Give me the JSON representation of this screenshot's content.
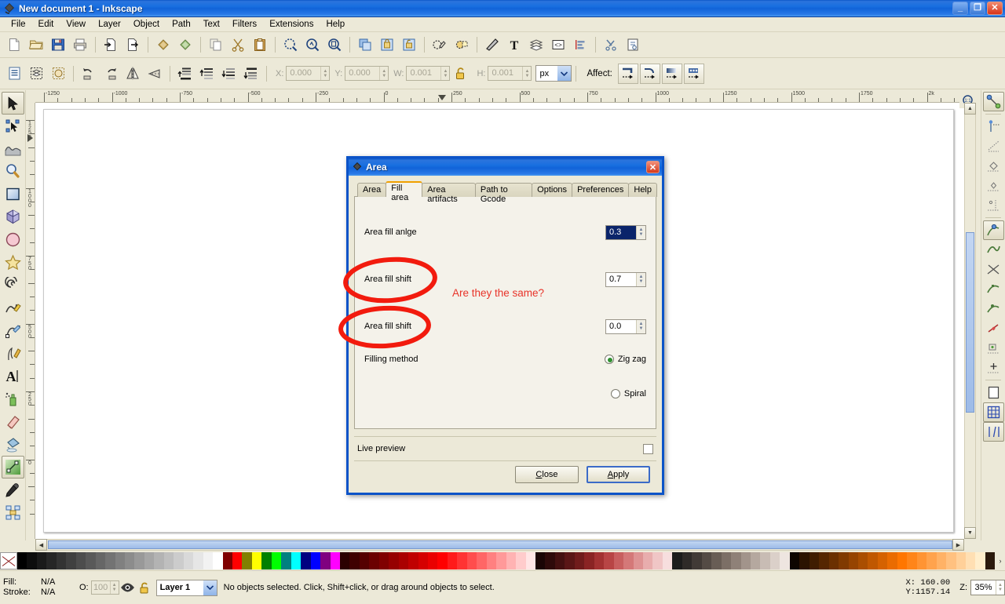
{
  "window": {
    "title": "New document 1 - Inkscape",
    "minimize_label": "_",
    "maximize_label": "❐",
    "close_label": "✕"
  },
  "menu": [
    {
      "label": "File"
    },
    {
      "label": "Edit"
    },
    {
      "label": "View"
    },
    {
      "label": "Layer"
    },
    {
      "label": "Object"
    },
    {
      "label": "Path"
    },
    {
      "label": "Text"
    },
    {
      "label": "Filters"
    },
    {
      "label": "Extensions"
    },
    {
      "label": "Help"
    }
  ],
  "command_bar": {
    "buttons": [
      "new-document-icon",
      "open-document-icon",
      "save-document-icon",
      "print-icon",
      "import-icon",
      "export-icon",
      "undo-icon",
      "redo-icon",
      "copy-icon",
      "cut-icon",
      "paste-icon",
      "zoom-selection-icon",
      "zoom-drawing-icon",
      "zoom-page-icon",
      "duplicate-icon",
      "group-icon",
      "ungroup-icon",
      "fill-stroke-dialog-icon",
      "object-properties-icon",
      "edit-gradient-icon",
      "text-tool-icon",
      "layers-dialog-icon",
      "xml-editor-icon",
      "align-dialog-icon",
      "preferences-icon",
      "document-properties-icon"
    ]
  },
  "selector_bar": {
    "buttons": [
      "select-all-icon",
      "select-all-in-layers-icon",
      "deselect-icon",
      "rotate-ccw-icon",
      "rotate-cw-icon",
      "flip-horizontal-icon",
      "flip-vertical-icon",
      "raise-to-top-icon",
      "raise-icon",
      "lower-icon",
      "lower-to-bottom-icon"
    ],
    "x_label": "X:",
    "x_value": "0.000",
    "y_label": "Y:",
    "y_value": "0.000",
    "w_label": "W:",
    "w_value": "0.001",
    "lock_icon": "unlocked-padlock-icon",
    "h_label": "H:",
    "h_value": "0.001",
    "unit_value": "px",
    "affect_label": "Affect:",
    "affect_buttons": [
      "scale-stroke-width-icon",
      "scale-rounded-corners-icon",
      "move-gradients-icon",
      "move-patterns-icon"
    ]
  },
  "tool_palette": {
    "tools": [
      {
        "name": "selector-tool",
        "active": true
      },
      {
        "name": "node-tool",
        "active": false
      },
      {
        "name": "tweak-tool",
        "active": false
      },
      {
        "name": "zoom-tool",
        "active": false
      },
      {
        "name": "rectangle-tool",
        "active": false
      },
      {
        "name": "3dbox-tool",
        "active": false
      },
      {
        "name": "ellipse-tool",
        "active": false
      },
      {
        "name": "star-tool",
        "active": false
      },
      {
        "name": "spiral-tool",
        "active": false
      },
      {
        "name": "pencil-tool",
        "active": false
      },
      {
        "name": "bezier-tool",
        "active": false
      },
      {
        "name": "calligraphy-tool",
        "active": false
      },
      {
        "name": "text-tool",
        "active": false
      },
      {
        "name": "spray-tool",
        "active": false
      },
      {
        "name": "eraser-tool",
        "active": false
      },
      {
        "name": "paint-bucket-tool",
        "active": false
      },
      {
        "name": "gradient-tool",
        "active": true
      },
      {
        "name": "dropper-tool",
        "active": false
      },
      {
        "name": "connector-tool",
        "active": false
      }
    ]
  },
  "snap_bar": {
    "buttons": [
      {
        "name": "enable-snapping-toggle",
        "on": true
      },
      {
        "name": "snap-bounding-box-toggle",
        "on": false
      },
      {
        "name": "snap-bbox-edges-toggle",
        "on": false
      },
      {
        "name": "snap-bbox-corners-toggle",
        "on": false
      },
      {
        "name": "snap-bbox-edge-midpoints-toggle",
        "on": false
      },
      {
        "name": "snap-bbox-centers-toggle",
        "on": false
      },
      {
        "name": "snap-nodes-paths-toggle",
        "on": true
      },
      {
        "name": "snap-paths-toggle",
        "on": false
      },
      {
        "name": "snap-path-intersections-toggle",
        "on": false
      },
      {
        "name": "snap-cusp-nodes-toggle",
        "on": false
      },
      {
        "name": "snap-smooth-nodes-toggle",
        "on": false
      },
      {
        "name": "snap-line-midpoints-toggle",
        "on": false
      },
      {
        "name": "snap-object-centers-toggle",
        "on": false
      },
      {
        "name": "snap-rotation-centers-toggle",
        "on": false
      },
      {
        "name": "snap-page-border-toggle",
        "on": false
      },
      {
        "name": "snap-grid-toggle",
        "on": true
      },
      {
        "name": "snap-guides-toggle",
        "on": true
      }
    ]
  },
  "rulers": {
    "horizontal_unit_ticks": [
      "-1250",
      "-1000",
      "-750",
      "-500",
      "-250",
      "0",
      "250",
      "500",
      "750",
      "1000",
      "1250",
      "1500",
      "1750",
      "2k"
    ],
    "vertical_unit_ticks": [
      "1250",
      "1000",
      "750",
      "500",
      "250",
      "0"
    ]
  },
  "canvas": {
    "zoom_1to1_icon": "zoom-1to1-icon"
  },
  "dialog": {
    "title": "Area",
    "icon": "inkscape-diamond-icon",
    "close_label": "✕",
    "tabs": [
      {
        "label": "Area",
        "selected": false
      },
      {
        "label": "Fill area",
        "selected": true
      },
      {
        "label": "Area artifacts",
        "selected": false
      },
      {
        "label": "Path to Gcode",
        "selected": false
      },
      {
        "label": "Options",
        "selected": false
      },
      {
        "label": "Preferences",
        "selected": false
      },
      {
        "label": "Help",
        "selected": false
      }
    ],
    "fields": [
      {
        "label": "Area fill anlge",
        "value": "0.3",
        "selected": true
      },
      {
        "label": "Area fill shift",
        "value": "0.7",
        "selected": false
      },
      {
        "label": "Area fill shift",
        "value": "0.0",
        "selected": false
      }
    ],
    "filling_method_label": "Filling method",
    "radios": [
      {
        "label": "Zig zag",
        "checked": true
      },
      {
        "label": "Spiral",
        "checked": false
      }
    ],
    "live_preview_label": "Live preview",
    "live_preview_checked": false,
    "buttons": {
      "close": "Close",
      "close_mnemonic": "C",
      "apply": "Apply",
      "apply_mnemonic": "A"
    }
  },
  "annotation": {
    "text": "Are they the same?",
    "color": "#e8342a",
    "ellipses": 2
  },
  "status_bar": {
    "fill_label": "Fill:",
    "fill_value": "N/A",
    "stroke_label": "Stroke:",
    "stroke_value": "N/A",
    "opacity_label": "O:",
    "opacity_value": "100",
    "visibility_icon": "eye-icon",
    "lock_icon": "padlock-icon",
    "layer_name": "Layer 1",
    "message": "No objects selected. Click, Shift+click, or drag around objects to select.",
    "x_label": "X:",
    "x_value": "160.00",
    "y_label": "Y:",
    "y_value": "1157.14",
    "zoom_label": "Z:",
    "zoom_value": "35%"
  },
  "palette": {
    "none_swatch_name": "no-color-swatch",
    "colors": [
      "#000000",
      "#0d0d0d",
      "#1a1a1a",
      "#262626",
      "#333333",
      "#404040",
      "#4d4d4d",
      "#595959",
      "#666666",
      "#737373",
      "#808080",
      "#8c8c8c",
      "#999999",
      "#a6a6a6",
      "#b3b3b3",
      "#bfbfbf",
      "#cccccc",
      "#d9d9d9",
      "#e6e6e6",
      "#f2f2f2",
      "#ffffff",
      "#800000",
      "#ff0000",
      "#808000",
      "#ffff00",
      "#008000",
      "#00ff00",
      "#008080",
      "#00ffff",
      "#000080",
      "#0000ff",
      "#800080",
      "#ff00ff",
      "#2b0000",
      "#3f0000",
      "#550000",
      "#6b0000",
      "#800000",
      "#960000",
      "#aa0000",
      "#c00000",
      "#d50000",
      "#ea0000",
      "#ff0000",
      "#ff1a1a",
      "#ff3333",
      "#ff4d4d",
      "#ff6666",
      "#ff8080",
      "#ff9999",
      "#ffb3b3",
      "#ffcccc",
      "#ffe6e6",
      "#1a0505",
      "#2e0a0a",
      "#441010",
      "#5a1616",
      "#701c1c",
      "#8a2424",
      "#a33232",
      "#b84545",
      "#c85f5f",
      "#d47878",
      "#de9393",
      "#e8adad",
      "#f0c6c6",
      "#f7dede",
      "#1c1c1c",
      "#2e2a28",
      "#413a36",
      "#544b45",
      "#685d55",
      "#7c6f66",
      "#8f8178",
      "#a2948b",
      "#b5a89f",
      "#c8bcb4",
      "#dbd0c9",
      "#eee5e0",
      "#0d0600",
      "#2b1300",
      "#3f1c00",
      "#552600",
      "#6b3000",
      "#803a00",
      "#964400",
      "#aa4e00",
      "#c05800",
      "#d56200",
      "#ea6c00",
      "#ff7600",
      "#ff8519",
      "#ff9433",
      "#ffa34d",
      "#ffb266",
      "#ffc180",
      "#ffd099",
      "#ffdfb3",
      "#ffeecc",
      "#2b1a0d"
    ],
    "left_arrow": "‹",
    "right_arrow": "›"
  }
}
